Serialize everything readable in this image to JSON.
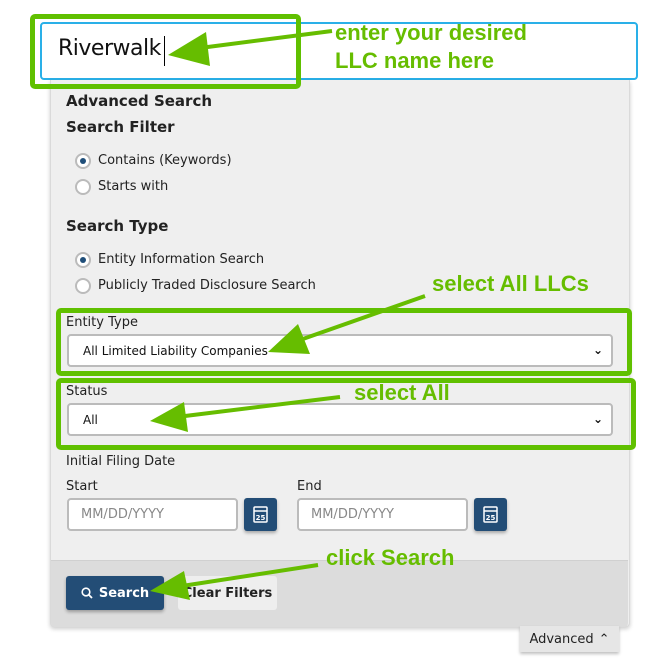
{
  "search": {
    "value": "Riverwalk"
  },
  "advanced_search": {
    "title": "Advanced Search",
    "search_filter": {
      "heading": "Search Filter",
      "options": [
        {
          "label": "Contains (Keywords)",
          "selected": true
        },
        {
          "label": "Starts with",
          "selected": false
        }
      ]
    },
    "search_type": {
      "heading": "Search Type",
      "options": [
        {
          "label": "Entity Information Search",
          "selected": true
        },
        {
          "label": "Publicly Traded Disclosure Search",
          "selected": false
        }
      ]
    },
    "entity_type": {
      "label": "Entity Type",
      "value": "All Limited Liability Companies"
    },
    "status": {
      "label": "Status",
      "value": "All"
    },
    "filing_date": {
      "label": "Initial Filing Date",
      "start_label": "Start",
      "end_label": "End",
      "start_placeholder": "MM/DD/YYYY",
      "end_placeholder": "MM/DD/YYYY",
      "calendar_day": "25"
    },
    "search_button": "Search",
    "clear_button": "Clear Filters",
    "advanced_toggle": "Advanced"
  },
  "annotations": {
    "enter_line1": "enter your desired",
    "enter_line2": "LLC name here",
    "select_llcs": "select All LLCs",
    "select_all": "select All",
    "click_search": "click Search",
    "color": "#66bd00"
  }
}
